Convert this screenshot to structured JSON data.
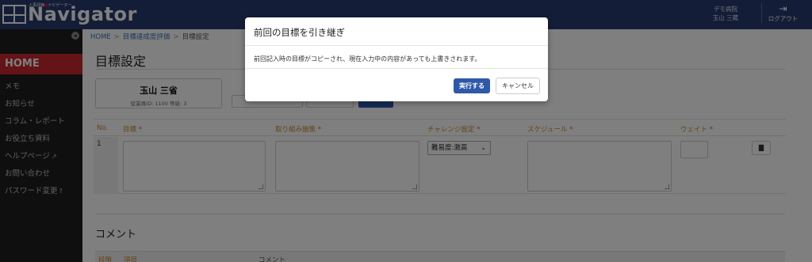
{
  "header": {
    "logo_text": "Navigator",
    "logo_tagline": "人事評価",
    "logo_tagline_accent": "●",
    "logo_tagline_2": "ナビゲーター",
    "org_name": "デモ病院",
    "user_name": "玉山 三蔵",
    "logout_label": "ログアウト",
    "logout_icon": "logout-icon"
  },
  "sidebar": {
    "home_label": "HOME",
    "items": [
      {
        "label": "メモ"
      },
      {
        "label": "お知らせ"
      },
      {
        "label": "コラム・レポート"
      },
      {
        "label": "お役立ち資料"
      },
      {
        "label": "ヘルプページ",
        "suffix": "↗"
      },
      {
        "label": "お問い合わせ"
      },
      {
        "label": "パスワード変更",
        "suffix": "?"
      }
    ]
  },
  "breadcrumb": {
    "home": "HOME",
    "sep": ">",
    "parent": "目標達成度評価",
    "current": "目標設定"
  },
  "page": {
    "title": "目標設定"
  },
  "employee": {
    "name": "玉山 三省",
    "meta": "従業員ID: 1100 等級: 3"
  },
  "goal_table": {
    "headers": {
      "no": "No.",
      "goal": "目標",
      "approach": "取り組み施策",
      "challenge": "チャレンジ設定",
      "schedule": "スケジュール",
      "weight": "ウェイト"
    },
    "required_mark": "*",
    "rows": [
      {
        "no": "1",
        "challenge_value": "難易度:激高",
        "delete_icon": "trash-icon"
      }
    ]
  },
  "comment_section": {
    "title": "コメント",
    "col_1": "段階",
    "col_2": "項目",
    "col_3": "コメント"
  },
  "modal": {
    "title": "前回の目標を引き継ぎ",
    "body": "前回記入時の目標がコピーされ、現在入力中の内容があっても上書きされます。",
    "execute_label": "実行する",
    "cancel_label": "キャンセル"
  },
  "colors": {
    "header_bg": "#283a6e",
    "sidebar_bg": "#1e1e1e",
    "home_active": "#c9292d",
    "primary_button": "#2f58a8",
    "table_header_text": "#c8862a"
  }
}
